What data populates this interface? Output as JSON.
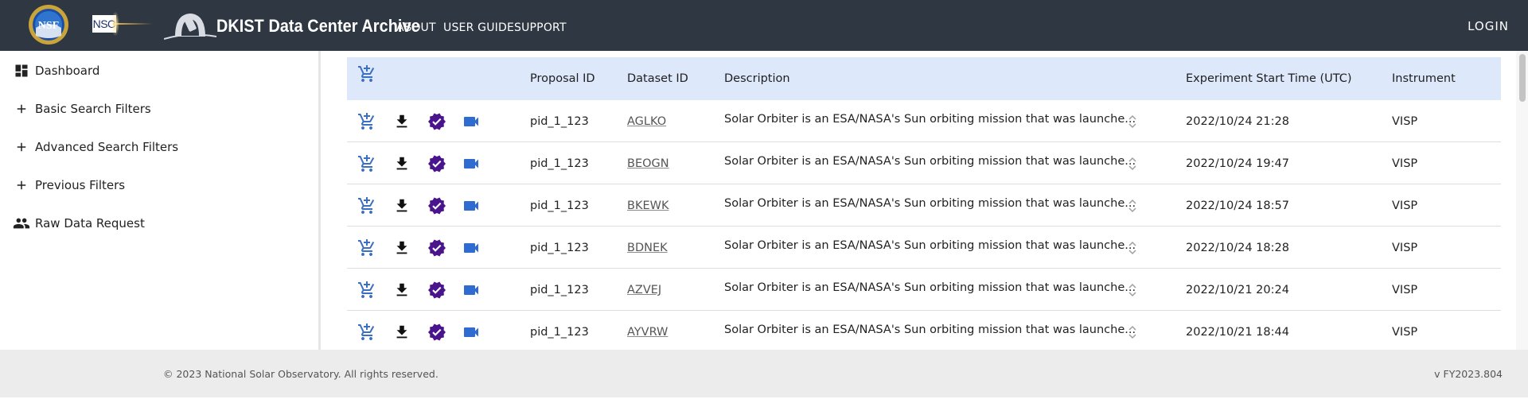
{
  "header": {
    "logos": {
      "nsf_text": "NSF",
      "nso_text": "NSO"
    },
    "title": "DKIST Data Center Archive",
    "nav": [
      "ABOUT",
      "USER GUIDE",
      "SUPPORT"
    ],
    "login": "LOGIN"
  },
  "sidebar": {
    "items": [
      {
        "label": "Dashboard",
        "icon": "dashboard-icon"
      },
      {
        "label": "Basic Search Filters",
        "icon": "plus-icon"
      },
      {
        "label": "Advanced Search Filters",
        "icon": "plus-icon"
      },
      {
        "label": "Previous Filters",
        "icon": "plus-icon"
      },
      {
        "label": "Raw Data Request",
        "icon": "people-icon"
      }
    ]
  },
  "table": {
    "columns": [
      "Proposal ID",
      "Dataset ID",
      "Description",
      "Experiment Start Time (UTC)",
      "Instrument"
    ],
    "rows": [
      {
        "proposal": "pid_1_123",
        "dataset": "AGLKO",
        "description": "Solar Orbiter is an ESA/NASA's Sun orbiting mission that was launche...",
        "start": "2022/10/24 21:28",
        "instrument": "VISP"
      },
      {
        "proposal": "pid_1_123",
        "dataset": "BEOGN",
        "description": "Solar Orbiter is an ESA/NASA's Sun orbiting mission that was launche...",
        "start": "2022/10/24 19:47",
        "instrument": "VISP"
      },
      {
        "proposal": "pid_1_123",
        "dataset": "BKEWK",
        "description": "Solar Orbiter is an ESA/NASA's Sun orbiting mission that was launche...",
        "start": "2022/10/24 18:57",
        "instrument": "VISP"
      },
      {
        "proposal": "pid_1_123",
        "dataset": "BDNEK",
        "description": "Solar Orbiter is an ESA/NASA's Sun orbiting mission that was launche...",
        "start": "2022/10/24 18:28",
        "instrument": "VISP"
      },
      {
        "proposal": "pid_1_123",
        "dataset": "AZVEJ",
        "description": "Solar Orbiter is an ESA/NASA's Sun orbiting mission that was launche...",
        "start": "2022/10/21 20:24",
        "instrument": "VISP"
      },
      {
        "proposal": "pid_1_123",
        "dataset": "AYVRW",
        "description": "Solar Orbiter is an ESA/NASA's Sun orbiting mission that was launche...",
        "start": "2022/10/21 18:44",
        "instrument": "VISP"
      }
    ]
  },
  "footer": {
    "copyright": "© 2023 National Solar Observatory. All rights reserved.",
    "version": "v FY2023.804"
  },
  "colors": {
    "header_bg": "#2e3742",
    "table_header_bg": "#dde8fb",
    "cart_blue": "#3b6fc4",
    "verified_purple": "#4a148c",
    "video_blue": "#2f6bd1",
    "footer_bg": "#ececec"
  }
}
